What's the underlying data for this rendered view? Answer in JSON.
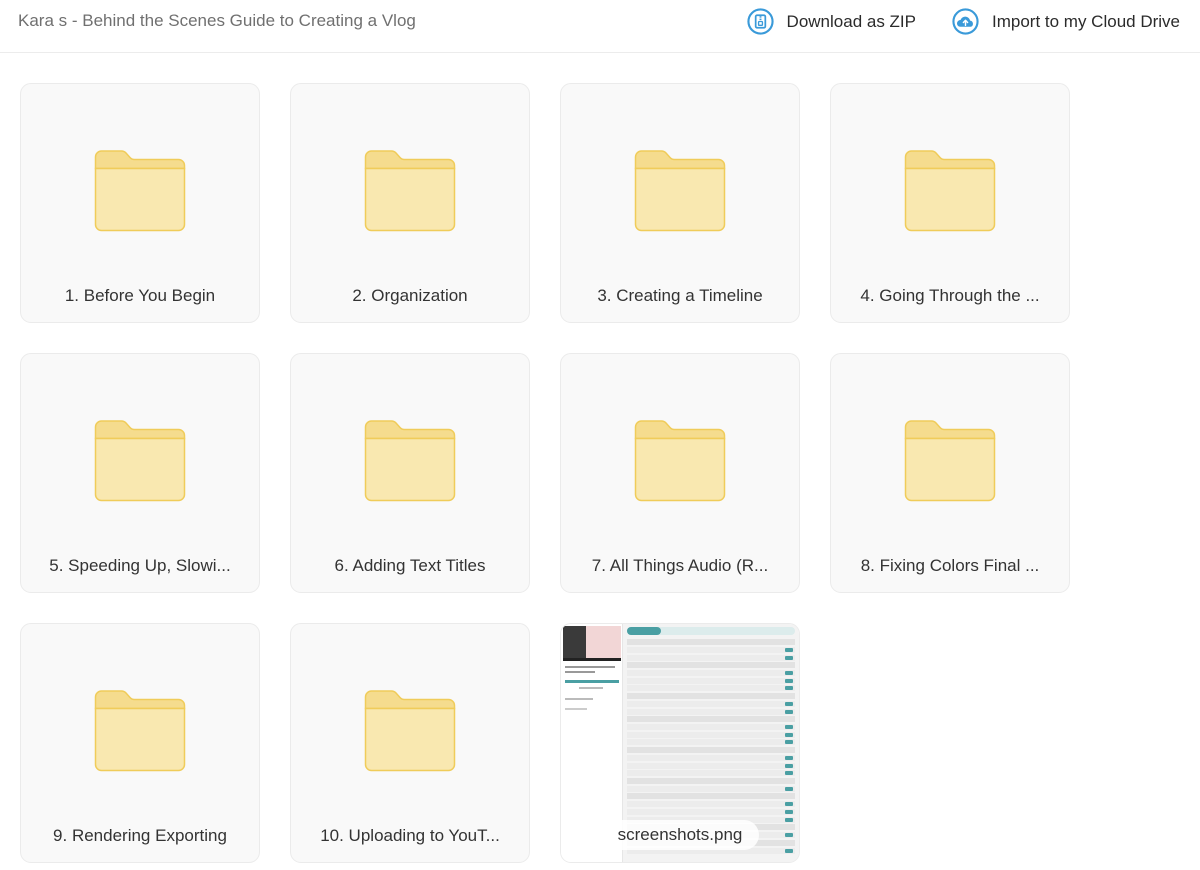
{
  "header": {
    "title": "Kara s - Behind the Scenes Guide to Creating a Vlog",
    "actions": [
      {
        "label": "Download as ZIP",
        "icon": "zip-archive-icon"
      },
      {
        "label": "Import to my Cloud Drive",
        "icon": "cloud-upload-icon"
      }
    ]
  },
  "colors": {
    "accent": "#3a9ad9",
    "folder_body": "#f9e8b0",
    "folder_tab": "#f5dc8e",
    "folder_stroke": "#f0cc5a",
    "card_bg": "#f9f9f9"
  },
  "items": [
    {
      "type": "folder",
      "label": "1. Before You Begin"
    },
    {
      "type": "folder",
      "label": "2. Organization"
    },
    {
      "type": "folder",
      "label": "3. Creating a Timeline"
    },
    {
      "type": "folder",
      "label": "4. Going Through the ..."
    },
    {
      "type": "folder",
      "label": "5. Speeding Up, Slowi..."
    },
    {
      "type": "folder",
      "label": "6. Adding Text Titles"
    },
    {
      "type": "folder",
      "label": "7. All Things Audio (R..."
    },
    {
      "type": "folder",
      "label": "8. Fixing Colors Final ..."
    },
    {
      "type": "folder",
      "label": "9. Rendering Exporting"
    },
    {
      "type": "folder",
      "label": "10. Uploading to YouT..."
    },
    {
      "type": "image",
      "label": "screenshots.png"
    }
  ]
}
